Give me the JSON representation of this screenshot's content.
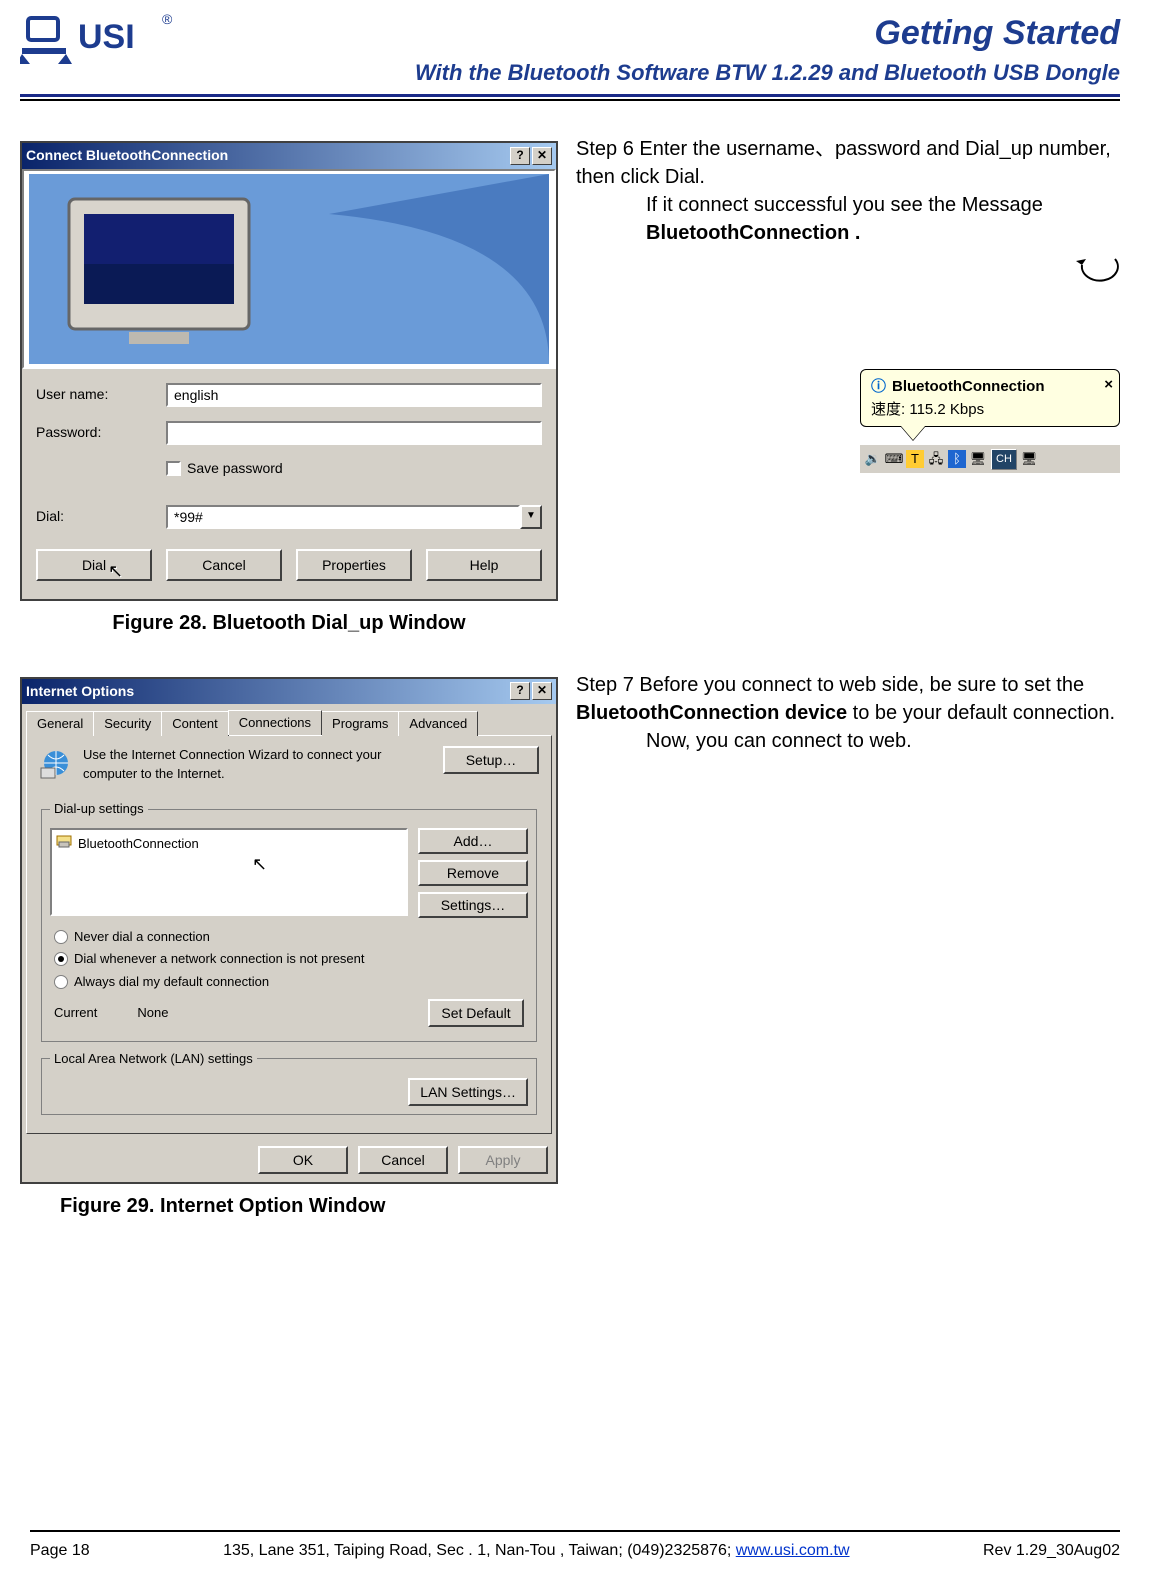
{
  "header": {
    "title_main": "Getting Started",
    "title_sub": "With the Bluetooth Software BTW 1.2.29 and Bluetooth USB Dongle"
  },
  "step6": {
    "label": "Step 6 ",
    "line1": "Enter the username、password and Dial_up number, then click Dial.",
    "line2": "If it connect successful you see the Message ",
    "bold": "BluetoothConnection ."
  },
  "dlg1": {
    "title": "Connect BluetoothConnection",
    "user_label": "User name:",
    "user_value": "english",
    "pwd_label": "Password:",
    "save_pwd": "Save password",
    "dial_label": "Dial:",
    "dial_value": "*99#",
    "btn_dial": "Dial",
    "btn_cancel": "Cancel",
    "btn_props": "Properties",
    "btn_help": "Help",
    "caption": "Figure 28. Bluetooth Dial_up Window"
  },
  "balloon": {
    "title": "BluetoothConnection",
    "line2": "速度: 115.2 Kbps"
  },
  "tray": {
    "ime_btn": "CH"
  },
  "step7": {
    "label": "Step 7 ",
    "line1a": "Before you connect to web side, be sure to set the ",
    "bold": "BluetoothConnection device",
    "line1b": " to be your default connection.",
    "line2": "Now, you can connect to web."
  },
  "dlg2": {
    "title": "Internet Options",
    "tabs": [
      "General",
      "Security",
      "Content",
      "Connections",
      "Programs",
      "Advanced"
    ],
    "active_tab_index": 3,
    "wizard_text": "Use the Internet Connection Wizard to connect your computer to the Internet.",
    "btn_setup": "Setup…",
    "dialup_legend": "Dial-up settings",
    "list_item": "BluetoothConnection",
    "btn_add": "Add…",
    "btn_remove": "Remove",
    "btn_settings": "Settings…",
    "radio_never": "Never dial a connection",
    "radio_whenever": "Dial whenever a network connection is not present",
    "radio_always": "Always dial my default connection",
    "current_label": "Current",
    "current_value": "None",
    "btn_setdefault": "Set Default",
    "lan_legend": "Local Area Network (LAN) settings",
    "btn_lan": "LAN Settings…",
    "btn_ok": "OK",
    "btn_cancel": "Cancel",
    "btn_apply": "Apply",
    "caption": "Figure 29. Internet Option Window"
  },
  "footer": {
    "page": "Page 18",
    "addr_pre": "135, Lane 351, Taiping Road, Sec . 1, Nan-Tou , Taiwan; (049)2325876; ",
    "link": "www.usi.com.tw",
    "rev": "Rev 1.29_30Aug02"
  }
}
